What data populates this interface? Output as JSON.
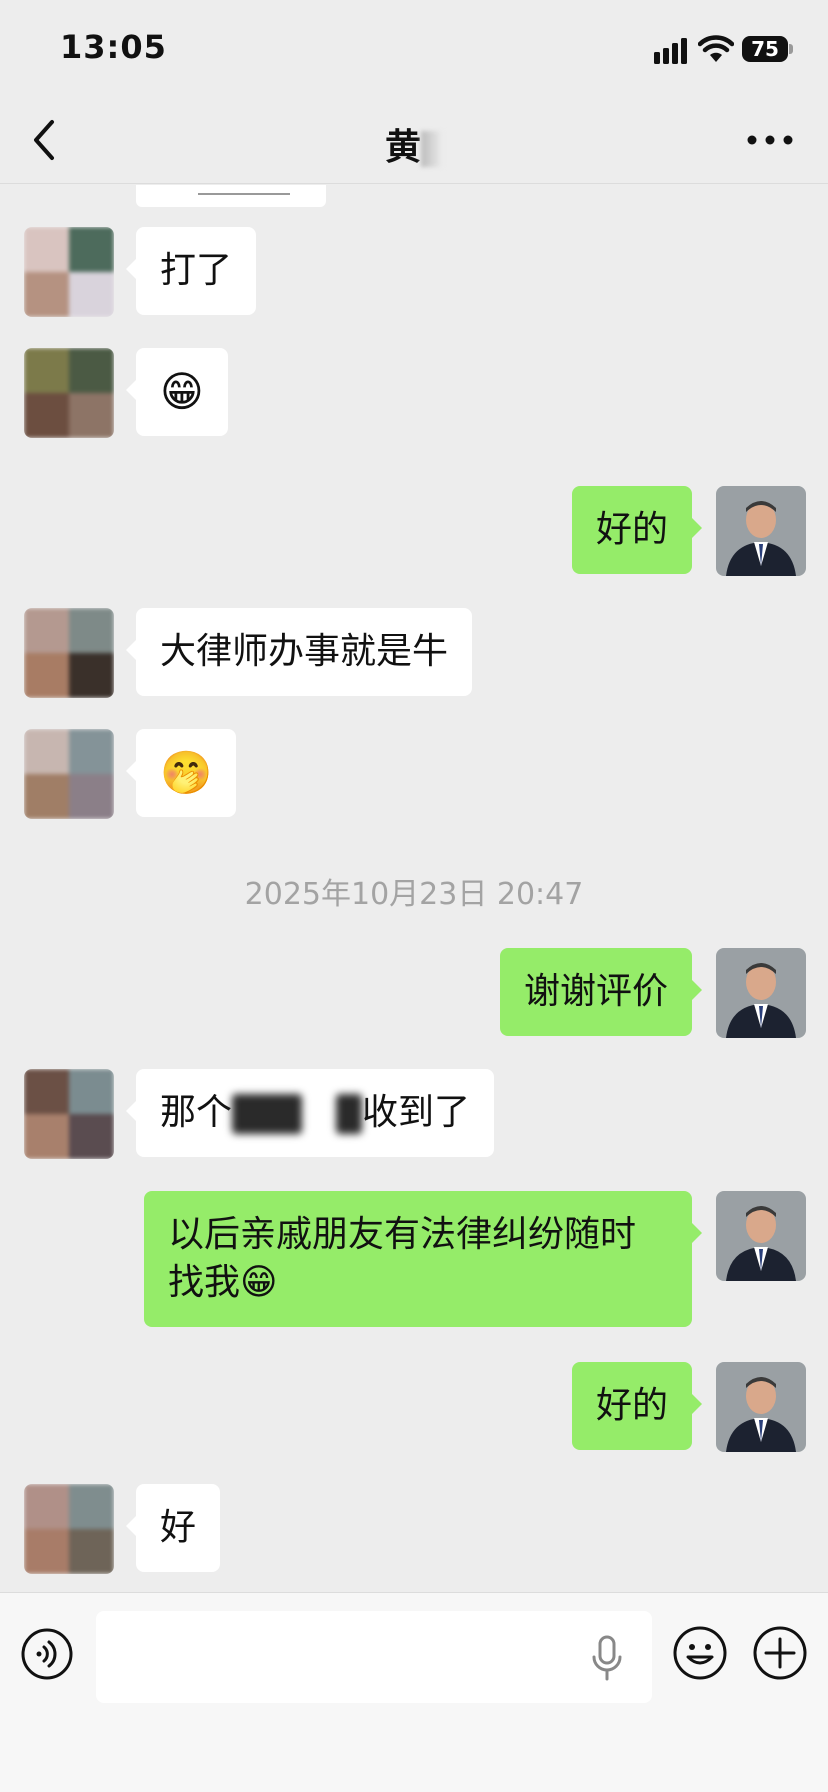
{
  "status_bar": {
    "time": "13:05",
    "battery": "75"
  },
  "nav": {
    "title": "黄"
  },
  "timestamp": "2025年10月23日 20:47",
  "messages": [
    {
      "side": "left",
      "text": "打了"
    },
    {
      "side": "left",
      "text": "😁"
    },
    {
      "side": "right",
      "text": "好的"
    },
    {
      "side": "left",
      "text": "大律师办事就是牛"
    },
    {
      "side": "left",
      "text": "🤭"
    },
    {
      "side": "right",
      "text": "谢谢评价"
    },
    {
      "side": "left",
      "text_before": "那个",
      "text_after": "收到了"
    },
    {
      "side": "right",
      "text": "以后亲戚朋友有法律纠纷随时找我😁"
    },
    {
      "side": "right",
      "text": "好的"
    },
    {
      "side": "left",
      "text": "好"
    }
  ],
  "input": {
    "value": "",
    "placeholder": ""
  },
  "colors": {
    "background": "#ededed",
    "my_bubble": "#95ec69",
    "their_bubble": "#ffffff"
  }
}
